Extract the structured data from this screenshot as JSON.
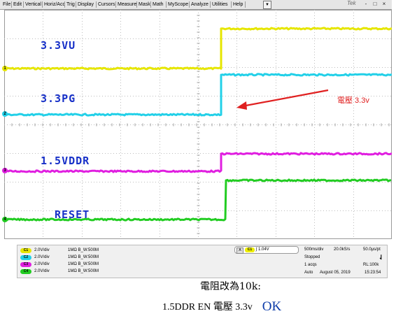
{
  "menu": {
    "items": [
      "File",
      "Edit",
      "Vertical",
      "Horiz/Acq",
      "Trig",
      "Display",
      "Cursors",
      "Measure",
      "Mask",
      "Math",
      "MyScope",
      "Analyze",
      "Utilities",
      "Help"
    ],
    "dropdown_glyph": "▼",
    "brand": "Tek",
    "window_buttons": [
      "-",
      "□",
      "×"
    ]
  },
  "traces": [
    {
      "label": "3.3VU",
      "color": "#e6e600",
      "channel": "1"
    },
    {
      "label": "3.3PG",
      "color": "#22d0e8",
      "channel": "2"
    },
    {
      "label": "1.5VDDR",
      "color": "#e01ee0",
      "channel": "3"
    },
    {
      "label": "RESET",
      "color": "#22cc22",
      "channel": "4"
    }
  ],
  "label_color": "#1730c8",
  "annotation": {
    "text": "電壓 3.3v",
    "color": "#e02020"
  },
  "status": {
    "channels": [
      {
        "badge": "C1",
        "volts": "2.0V/div",
        "impedance": "1MΩ  B_W:500M",
        "color": "#e6e600"
      },
      {
        "badge": "C2",
        "volts": "2.0V/div",
        "impedance": "1MΩ  B_W:500M",
        "color": "#22d0e8"
      },
      {
        "badge": "C3",
        "volts": "2.0V/div",
        "impedance": "1MΩ  B_W:500M",
        "color": "#e01ee0"
      },
      {
        "badge": "C4",
        "volts": "2.0V/div",
        "impedance": "1MΩ  B_W:500M",
        "color": "#22cc22"
      }
    ],
    "trigger": {
      "mode": "A",
      "source": "C1",
      "slope": "∫",
      "level": "1.04V"
    },
    "acquisition": {
      "timebase": "500ms/div",
      "rate": "20.0kS/s",
      "resolution": "50.0μs/pt",
      "state": "Stopped",
      "acqs": "1 acqs",
      "record": "RL:100k",
      "trig_mode": "Auto",
      "date": "August 05, 2019",
      "time": "15:23:54"
    }
  },
  "notes": {
    "line1": "電阻改為10k:",
    "line2": "1.5DDR EN 電壓 3.3v",
    "ok": "OK"
  }
}
